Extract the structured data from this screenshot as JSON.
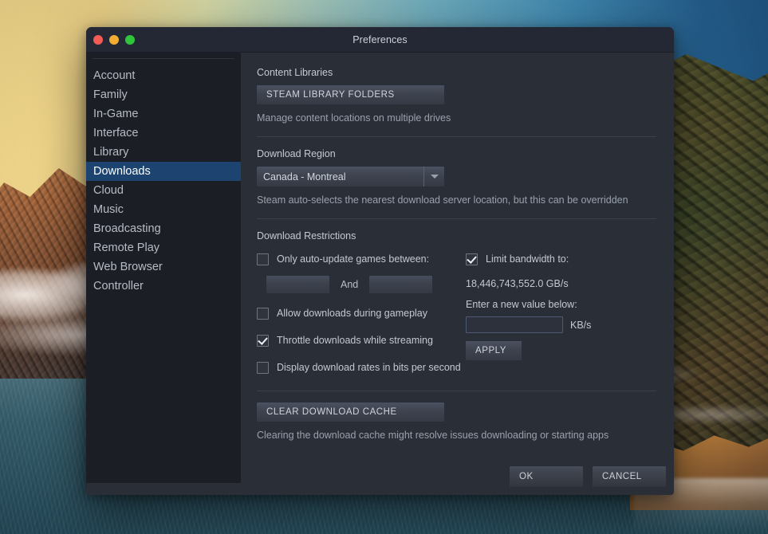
{
  "window": {
    "title": "Preferences",
    "traffic_lights": [
      {
        "name": "close",
        "color": "#f25c54"
      },
      {
        "name": "minimize",
        "color": "#f3ad33"
      },
      {
        "name": "maximize",
        "color": "#2fc63b"
      }
    ]
  },
  "sidebar": {
    "items": [
      {
        "label": "Account",
        "selected": false
      },
      {
        "label": "Family",
        "selected": false
      },
      {
        "label": "In-Game",
        "selected": false
      },
      {
        "label": "Interface",
        "selected": false
      },
      {
        "label": "Library",
        "selected": false
      },
      {
        "label": "Downloads",
        "selected": true
      },
      {
        "label": "Cloud",
        "selected": false
      },
      {
        "label": "Music",
        "selected": false
      },
      {
        "label": "Broadcasting",
        "selected": false
      },
      {
        "label": "Remote Play",
        "selected": false
      },
      {
        "label": "Web Browser",
        "selected": false
      },
      {
        "label": "Controller",
        "selected": false
      }
    ],
    "selected_color": "#1d4470"
  },
  "content": {
    "content_libraries": {
      "heading": "Content Libraries",
      "button_label": "STEAM LIBRARY FOLDERS",
      "hint": "Manage content locations on multiple drives"
    },
    "download_region": {
      "heading": "Download Region",
      "selected_value": "Canada - Montreal",
      "hint": "Steam auto-selects the nearest download server location, but this can be overridden"
    },
    "download_restrictions": {
      "heading": "Download Restrictions",
      "auto_update": {
        "label": "Only auto-update games between:",
        "checked": false,
        "from_value": "",
        "and_label": "And",
        "to_value": ""
      },
      "allow_downloads_gameplay": {
        "label": "Allow downloads during gameplay",
        "checked": false
      },
      "throttle_while_streaming": {
        "label": "Throttle downloads while streaming",
        "checked": true
      },
      "display_rates_bits": {
        "label": "Display download rates in bits per second",
        "checked": false
      },
      "limit_bandwidth": {
        "label": "Limit bandwidth to:",
        "checked": true,
        "current_value": "18,446,743,552.0 GB/s",
        "new_value_label": "Enter a new value below:",
        "input_value": "",
        "input_placeholder": "",
        "units": "KB/s",
        "apply_label": "APPLY"
      }
    },
    "download_cache": {
      "button_label": "CLEAR DOWNLOAD CACHE",
      "hint": "Clearing the download cache might resolve issues downloading or starting apps"
    }
  },
  "actions": {
    "ok_label": "OK",
    "cancel_label": "CANCEL"
  }
}
